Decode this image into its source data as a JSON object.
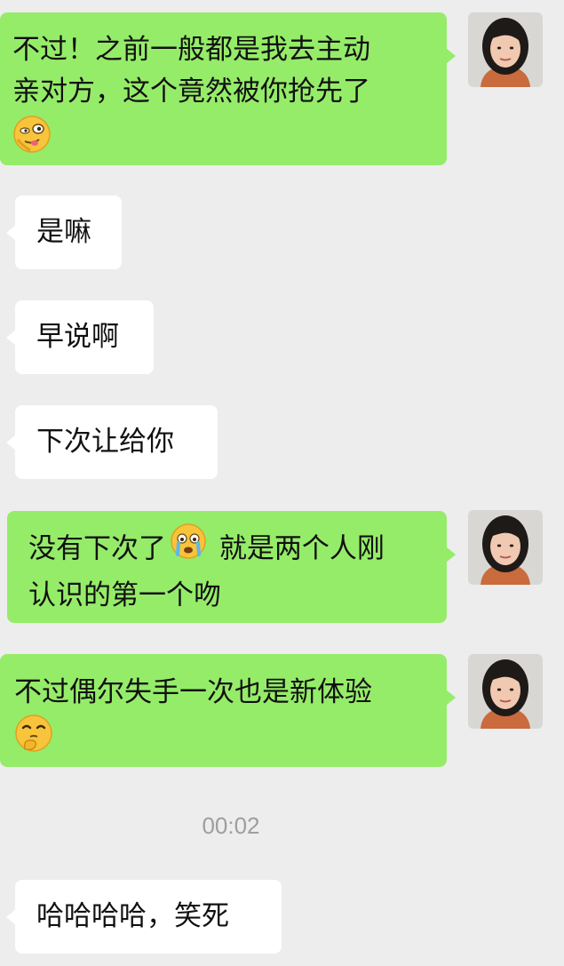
{
  "messages": [
    {
      "direction": "out",
      "lines": [
        "不过！之前一般都是我去主动",
        "亲对方，这个竟然被你抢先了"
      ],
      "emoji": "smirk-tongue-emoji"
    },
    {
      "direction": "in",
      "text": "是嘛"
    },
    {
      "direction": "in",
      "text": "早说啊"
    },
    {
      "direction": "in",
      "text": "下次让给你"
    },
    {
      "direction": "out",
      "line1_before": "没有下次了",
      "emoji": "crying-emoji",
      "line1_after": " 就是两个人刚",
      "line2": "认识的第一个吻"
    },
    {
      "direction": "out",
      "lines": [
        "不过偶尔失手一次也是新体验"
      ],
      "emoji": "thinking-emoji"
    },
    {
      "direction": "in",
      "text": "哈哈哈哈，笑死"
    }
  ],
  "timestamp": "00:02",
  "colors": {
    "background": "#ededed",
    "outgoing_bubble": "#95ec69",
    "incoming_bubble": "#ffffff",
    "timestamp_text": "#9e9e9e"
  },
  "avatar": {
    "icon": "user-avatar-photo"
  }
}
